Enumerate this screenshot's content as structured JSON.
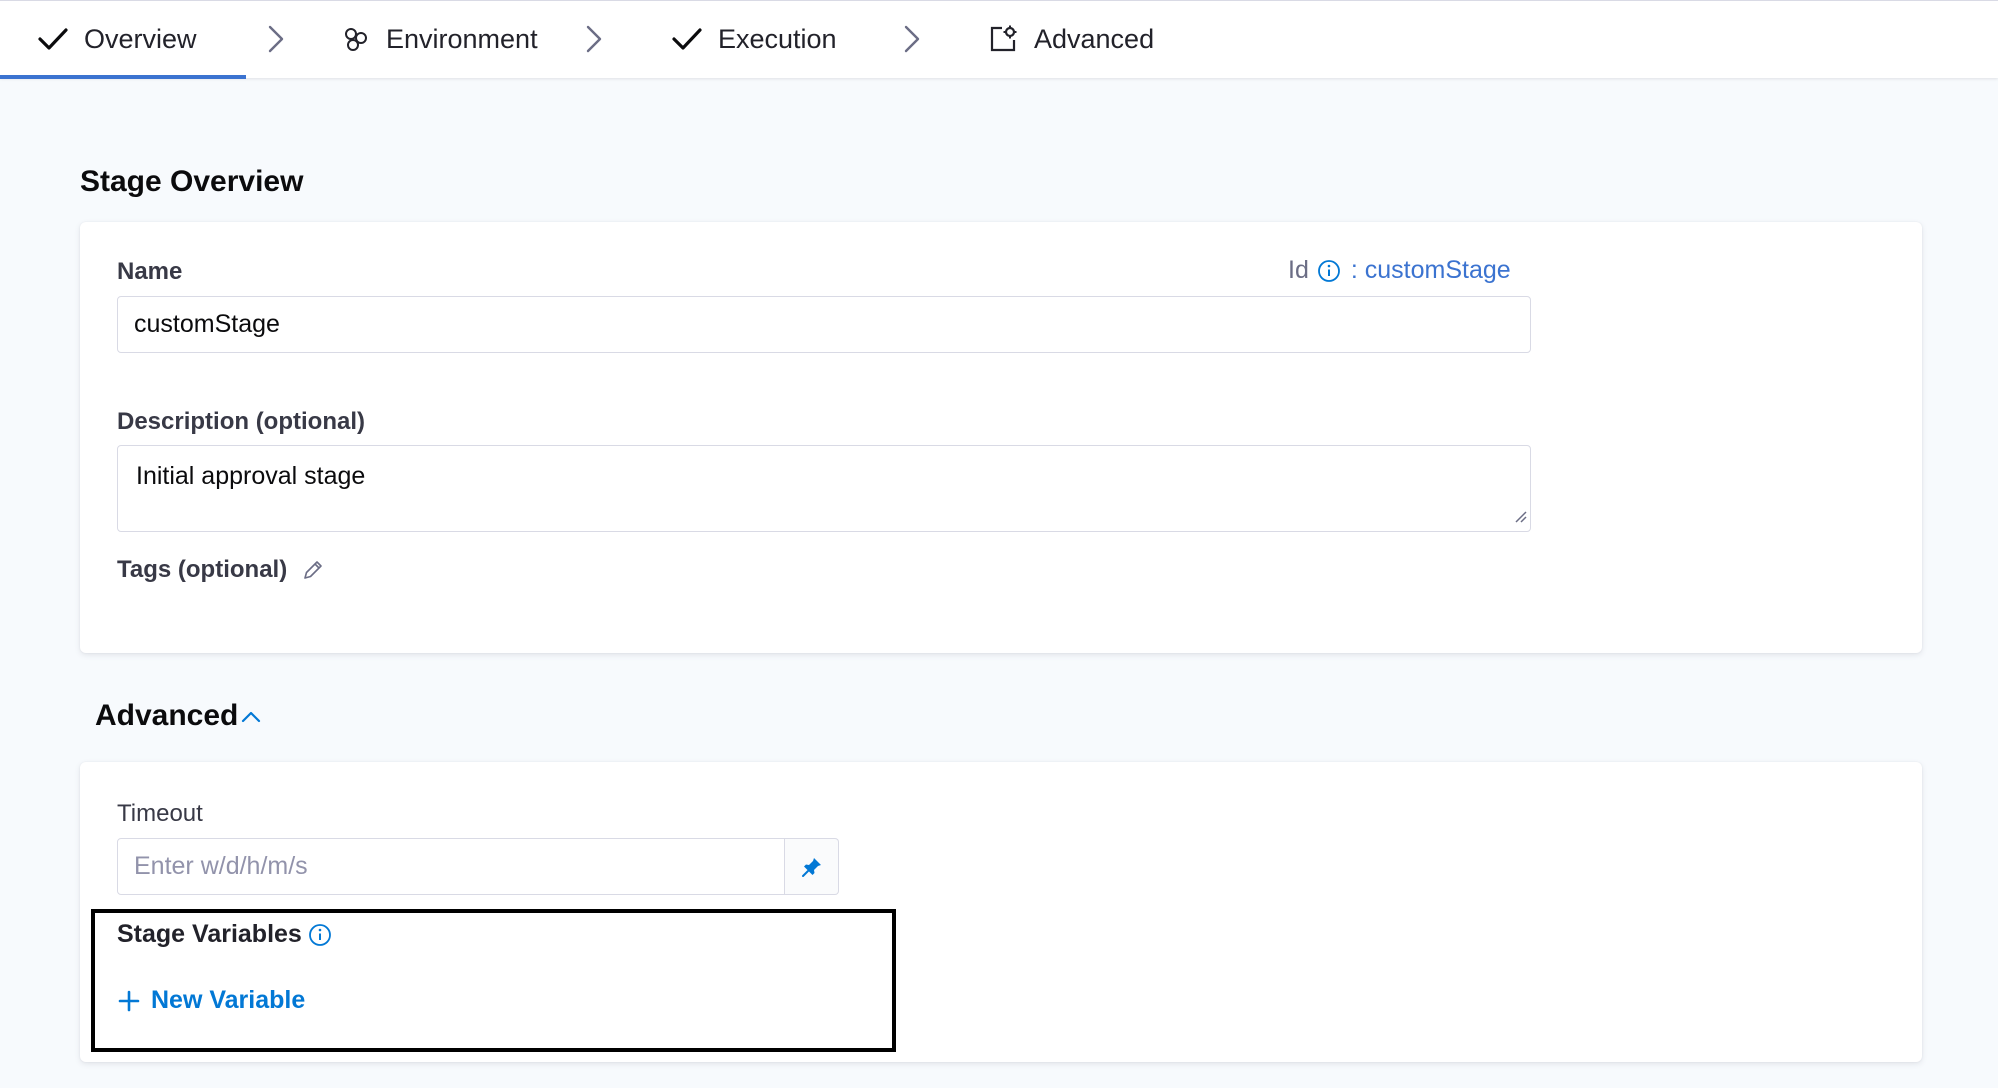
{
  "tabs": [
    {
      "label": "Overview",
      "icon": "check-icon"
    },
    {
      "label": "Environment",
      "icon": "environment-icon"
    },
    {
      "label": "Execution",
      "icon": "check-icon"
    },
    {
      "label": "Advanced",
      "icon": "advanced-settings-icon"
    }
  ],
  "stage_overview": {
    "title": "Stage Overview",
    "name_label": "Name",
    "id_label": "Id",
    "id_value": ": customStage",
    "name_value": "customStage",
    "description_label": "Description (optional)",
    "description_value": "Initial approval stage",
    "tags_label": "Tags (optional)"
  },
  "advanced": {
    "title": "Advanced",
    "timeout_label": "Timeout",
    "timeout_placeholder": "Enter w/d/h/m/s",
    "stage_variables_label": "Stage Variables",
    "new_variable_label": "New Variable"
  },
  "colors": {
    "accent": "#3b73d0",
    "link": "#0278d5",
    "background": "#f7fafd"
  }
}
